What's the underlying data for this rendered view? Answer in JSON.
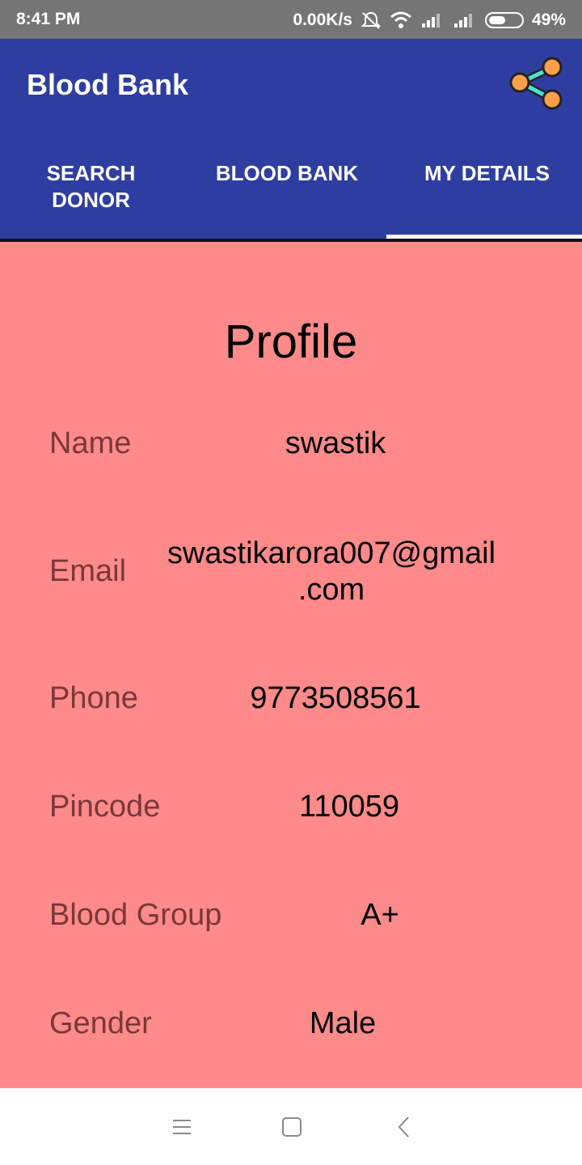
{
  "status_bar": {
    "time": "8:41 PM",
    "net_speed": "0.00K/s",
    "battery_percent": "49%",
    "icons": [
      "mute-icon",
      "wifi-icon",
      "signal-icon",
      "signal-icon",
      "battery-icon"
    ]
  },
  "app_bar": {
    "title": "Blood Bank",
    "share_icon": "share-icon",
    "colors": {
      "background": "#2e3ea0",
      "share_fill": "#ff9f4a",
      "share_line": "#4de0d6"
    }
  },
  "tabs": [
    {
      "label": "SEARCH DONOR",
      "selected": false
    },
    {
      "label": "BLOOD BANK",
      "selected": false
    },
    {
      "label": "MY DETAILS",
      "selected": true
    }
  ],
  "profile": {
    "title": "Profile",
    "rows": [
      {
        "label": "Name",
        "value": "swastik"
      },
      {
        "label": "Email",
        "value_line1": "swastikarora007@gmail",
        "value_line2": ".com"
      },
      {
        "label": "Phone",
        "value": "9773508561"
      },
      {
        "label": "Pincode",
        "value": "110059"
      },
      {
        "label": "Blood Group",
        "value": "A+"
      },
      {
        "label": "Gender",
        "value": "Male"
      }
    ],
    "colors": {
      "background": "#ff8a8a",
      "label": "#7a3838",
      "value": "#000000"
    }
  },
  "nav_bar": {
    "icons": [
      "menu-icon",
      "home-icon",
      "back-icon"
    ]
  }
}
